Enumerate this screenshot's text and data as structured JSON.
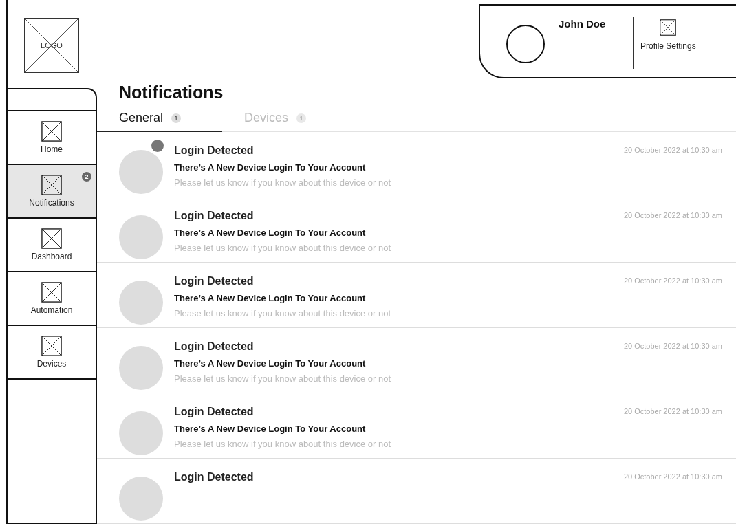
{
  "logo": {
    "text": "LOGO"
  },
  "profile": {
    "name": "John Doe",
    "settings_label": "Profile Settings"
  },
  "sidebar": {
    "items": [
      {
        "label": "Home",
        "selected": false
      },
      {
        "label": "Notifications",
        "selected": true,
        "badge": "2"
      },
      {
        "label": "Dashboard",
        "selected": false
      },
      {
        "label": "Automation",
        "selected": false
      },
      {
        "label": "Devices",
        "selected": false
      }
    ]
  },
  "page_title": "Notifications",
  "tabs": [
    {
      "label": "General",
      "count": "1",
      "selected": true
    },
    {
      "label": "Devices",
      "count": "1",
      "selected": false
    }
  ],
  "notifications": [
    {
      "title": "Login Detected",
      "subtitle": "There’s A New Device Login To Your Account",
      "description": "Please let us know if you know about this device or not",
      "time": "20 October 2022 at 10:30 am",
      "unread": true
    },
    {
      "title": "Login Detected",
      "subtitle": "There’s A New Device Login To Your Account",
      "description": "Please let us know if you know about this device or not",
      "time": "20 October 2022 at 10:30 am",
      "unread": false
    },
    {
      "title": "Login Detected",
      "subtitle": "There’s A New Device Login To Your Account",
      "description": "Please let us know if you know about this device or not",
      "time": "20 October 2022 at 10:30 am",
      "unread": false
    },
    {
      "title": "Login Detected",
      "subtitle": "There’s A New Device Login To Your Account",
      "description": "Please let us know if you know about this device or not",
      "time": "20 October 2022 at 10:30 am",
      "unread": false
    },
    {
      "title": "Login Detected",
      "subtitle": "There’s A New Device Login To Your Account",
      "description": "Please let us know if you know about this device or not",
      "time": "20 October 2022 at 10:30 am",
      "unread": false
    },
    {
      "title": "Login Detected",
      "time": "20 October 2022 at 10:30 am",
      "unread": false
    }
  ]
}
